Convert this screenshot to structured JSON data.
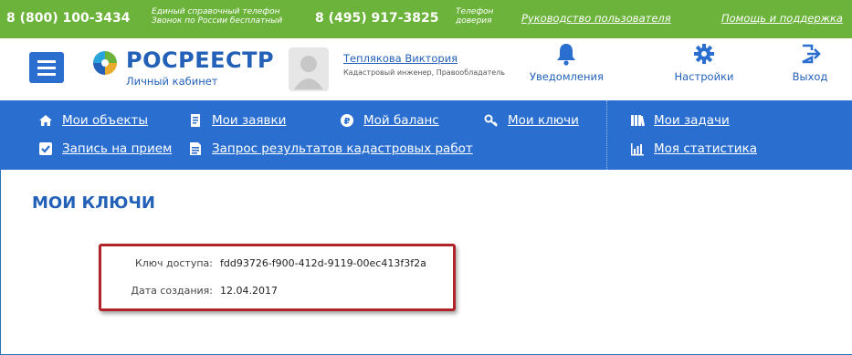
{
  "topbar": {
    "phone1": "8 (800) 100-3434",
    "phone1_note_line1": "Единый справочный телефон",
    "phone1_note_line2": "Звонок по России бесплатный",
    "phone2": "8 (495) 917-3825",
    "phone2_note_line1": "Телефон",
    "phone2_note_line2": "доверия",
    "link_manual": "Руководство пользователя",
    "link_help": "Помощь и поддержка",
    "color": "#6bb33a"
  },
  "header": {
    "logo_title": "РОСРЕЕСТР",
    "logo_subtitle": "Личный кабинет",
    "user_name": "Теплякова Виктория",
    "user_role": "Кадастровый инженер, Правообладатель",
    "notifications_label": "Уведомления",
    "settings_label": "Настройки",
    "logout_label": "Выход"
  },
  "nav": {
    "color": "#2a6fd0",
    "items": [
      {
        "label": "Мои объекты",
        "icon": "home-icon"
      },
      {
        "label": "Мои заявки",
        "icon": "document-icon"
      },
      {
        "label": "Мой баланс",
        "icon": "ruble-coin-icon"
      },
      {
        "label": "Мои ключи",
        "icon": "key-icon"
      },
      {
        "label": "Мои задачи",
        "icon": "books-icon"
      },
      {
        "label": "Запись на прием",
        "icon": "checkbox-icon"
      },
      {
        "label": "Запрос результатов кадастровых работ",
        "icon": "document-list-icon"
      },
      {
        "label": "Моя статистика",
        "icon": "bar-chart-icon"
      }
    ]
  },
  "main": {
    "page_title": "МОИ КЛЮЧИ",
    "access_key_label": "Ключ доступа:",
    "access_key_value": "fdd93726-f900-412d-9119-00ec413f3f2a",
    "created_label": "Дата создания:",
    "created_value": "12.04.2017",
    "highlight_color": "#b0232b"
  }
}
